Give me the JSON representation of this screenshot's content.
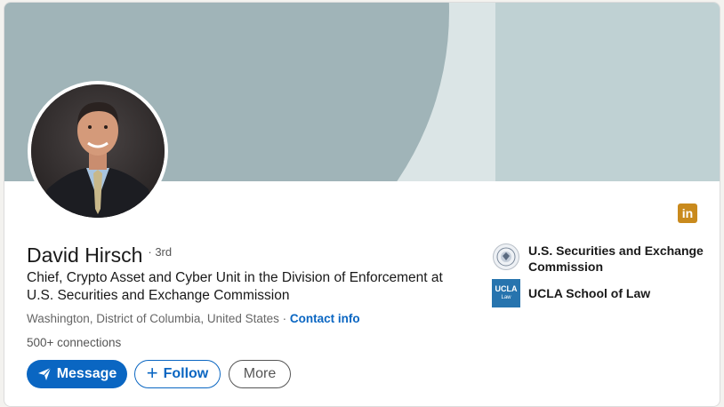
{
  "profile": {
    "name": "David Hirsch",
    "degree": "· 3rd",
    "headline": "Chief, Crypto Asset and Cyber Unit in the Division of Enforcement at U.S. Securities and Exchange Commission",
    "location": "Washington, District of Columbia, United States",
    "separator": " · ",
    "contact_info": "Contact info",
    "connections": "500+ connections"
  },
  "actions": {
    "message": "Message",
    "follow": "Follow",
    "more": "More"
  },
  "experience": [
    {
      "name": "U.S. Securities and Exchange Commission",
      "logo": "sec-seal-logo"
    },
    {
      "name": "UCLA School of Law",
      "logo": "ucla-law-logo",
      "logo_text": "UCLA",
      "logo_subtext": "Law"
    }
  ],
  "badge": {
    "text": "in",
    "icon": "linkedin-icon"
  },
  "colors": {
    "accent": "#0a66c2",
    "banner_light": "#dbe5e6",
    "banner_mid": "#bfd1d3",
    "banner_dark": "#a0b4b8",
    "badge": "#c98a1d",
    "ucla_blue": "#2774ae"
  }
}
